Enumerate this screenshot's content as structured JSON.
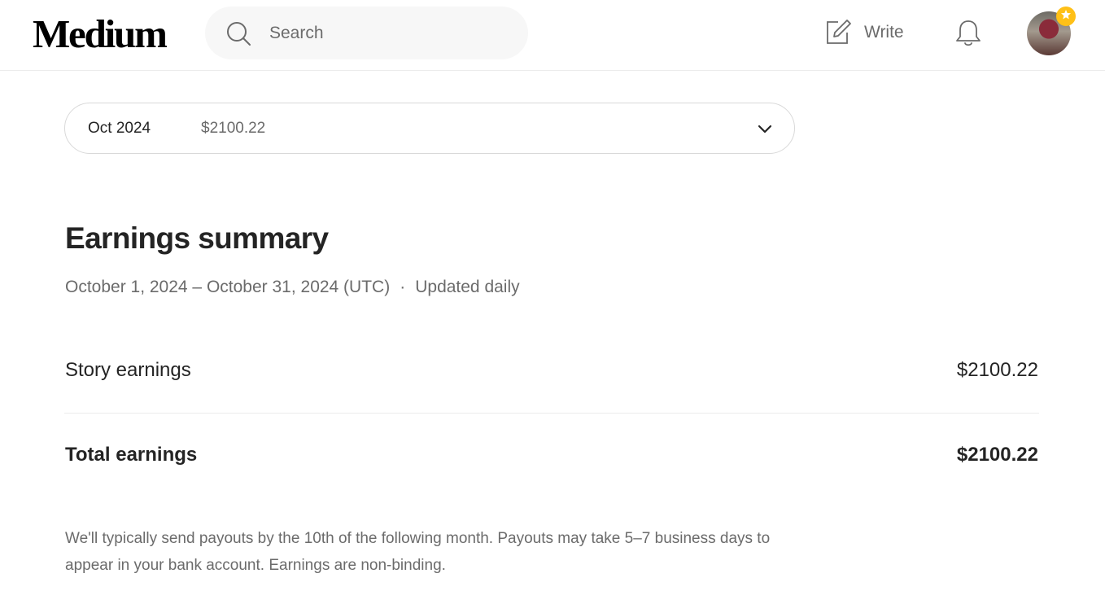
{
  "header": {
    "logo": "Medium",
    "search": {
      "placeholder": "Search",
      "value": ""
    },
    "write_label": "Write",
    "icons": {
      "search": "search-icon",
      "write": "pencil-square-icon",
      "notifications": "bell-icon",
      "badge": "star-icon"
    },
    "colors": {
      "badge": "#ffc017"
    }
  },
  "month_selector": {
    "month": "Oct 2024",
    "amount": "$2100.22"
  },
  "summary": {
    "title": "Earnings summary",
    "date_range": "October 1, 2024 – October 31, 2024 (UTC)",
    "separator": "·",
    "update_note": "Updated daily"
  },
  "earnings": {
    "story": {
      "label": "Story earnings",
      "value": "$2100.22"
    },
    "total": {
      "label": "Total earnings",
      "value": "$2100.22"
    }
  },
  "footnote": "We'll typically send payouts by the 10th of the following month. Payouts may take 5–7 business days to appear in your bank account. Earnings are non-binding."
}
